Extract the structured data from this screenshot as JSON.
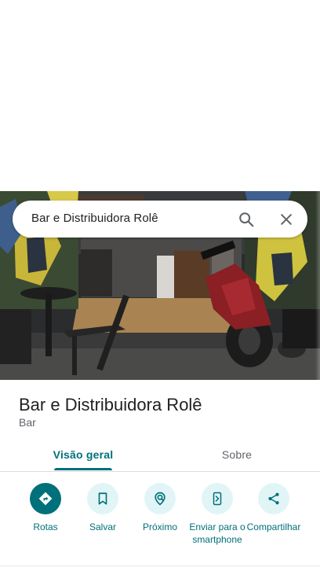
{
  "search": {
    "query": "Bar e Distribuidora Rolê"
  },
  "place": {
    "name": "Bar e Distribuidora Rolê",
    "category": "Bar"
  },
  "tabs": [
    {
      "label": "Visão geral",
      "active": true
    },
    {
      "label": "Sobre",
      "active": false
    }
  ],
  "actions": [
    {
      "label": "Rotas",
      "icon": "directions-icon"
    },
    {
      "label": "Salvar",
      "icon": "bookmark-icon"
    },
    {
      "label": "Próximo",
      "icon": "nearby-icon"
    },
    {
      "label": "Enviar para o smartphone",
      "icon": "send-to-phone-icon"
    },
    {
      "label": "Compartilhar",
      "icon": "share-icon"
    }
  ],
  "colors": {
    "accent": "#00707a",
    "action_bg": "#e1f5f7",
    "text_primary": "#202124",
    "text_secondary": "#5f6368"
  }
}
